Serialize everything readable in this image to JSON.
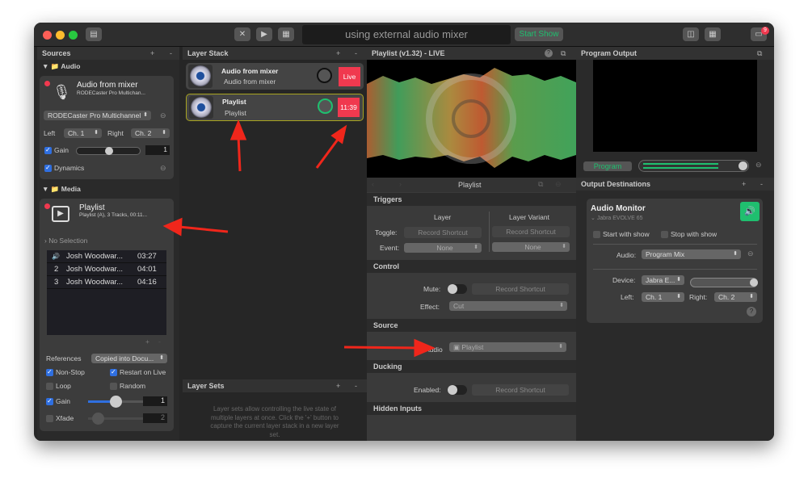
{
  "window": {
    "title": "using external audio mixer",
    "start_show": "Start Show",
    "badge_count": "9"
  },
  "sources": {
    "header": "Sources",
    "add": "+",
    "remove": "-",
    "audio_group": "Audio",
    "audio_source": {
      "name": "Audio from mixer",
      "device": "RODECaster Pro Multichan...",
      "device_select": "RODECaster Pro Multichannel",
      "left_label": "Left",
      "left_value": "Ch. 1",
      "right_label": "Right",
      "right_value": "Ch. 2",
      "gain_label": "Gain",
      "gain_value": "1",
      "gain_checked": true,
      "dynamics_label": "Dynamics",
      "dynamics_checked": true
    },
    "media_group": "Media",
    "media_source": {
      "name": "Playlist",
      "info": "Playlist (A), 3 Tracks, 00:11...",
      "no_selection": "No Selection",
      "tracks": [
        {
          "num": "",
          "title": "Josh Woodwar...",
          "duration": "03:27",
          "playing": true
        },
        {
          "num": "2",
          "title": "Josh Woodwar...",
          "duration": "04:01"
        },
        {
          "num": "3",
          "title": "Josh Woodwar...",
          "duration": "04:16"
        }
      ],
      "references_label": "References",
      "references_value": "Copied into Docu...",
      "non_stop": "Non-Stop",
      "restart_on_live": "Restart on Live",
      "loop": "Loop",
      "random": "Random",
      "gain_label": "Gain",
      "gain_value": "1",
      "xfade_label": "Xfade",
      "xfade_value": "2"
    }
  },
  "layer_stack": {
    "header": "Layer Stack",
    "add": "+",
    "remove": "-",
    "layers": [
      {
        "title": "Audio from mixer",
        "subtitle": "Audio from mixer",
        "status": "Live"
      },
      {
        "title": "Playlist",
        "subtitle": "Playlist",
        "status": "11:39",
        "selected": true
      }
    ]
  },
  "layer_sets": {
    "header": "Layer Sets",
    "add": "+",
    "remove": "-",
    "help": "Layer sets allow controlling the live state of multiple layers at once. Click the '+' button to capture the current layer stack in a new layer set."
  },
  "inspector": {
    "header": "Playlist (v1.32) - LIVE",
    "help": "?",
    "nav_title": "Playlist",
    "triggers": "Triggers",
    "layer_col": "Layer",
    "variant_col": "Layer Variant",
    "toggle_label": "Toggle:",
    "event_label": "Event:",
    "record_shortcut": "Record Shortcut",
    "event_value": "None",
    "variant_event_value": "None",
    "control": "Control",
    "mute_label": "Mute:",
    "effect_label": "Effect:",
    "effect_value": "Cut",
    "source": "Source",
    "audio_label": "Audio",
    "audio_value": "Playlist",
    "ducking": "Ducking",
    "enabled_label": "Enabled:",
    "hidden_inputs": "Hidden Inputs"
  },
  "program": {
    "header": "Program Output",
    "program_button": "Program"
  },
  "outputs": {
    "header": "Output Destinations",
    "add": "+",
    "remove": "-",
    "monitor": {
      "title": "Audio Monitor",
      "device_sub": "Jabra EVOLVE 65",
      "start_with_show": "Start with show",
      "stop_with_show": "Stop with show",
      "audio_label": "Audio:",
      "audio_value": "Program Mix",
      "device_label": "Device:",
      "device_value": "Jabra E...",
      "left_label": "Left:",
      "left_value": "Ch. 1",
      "right_label": "Right:",
      "right_value": "Ch. 2",
      "help": "?"
    }
  },
  "colors": {
    "live_red": "#f0394f",
    "accent_green": "#1fbf6f",
    "selection_yellow": "#a8a420",
    "annotation_arrow": "#f0261b"
  }
}
